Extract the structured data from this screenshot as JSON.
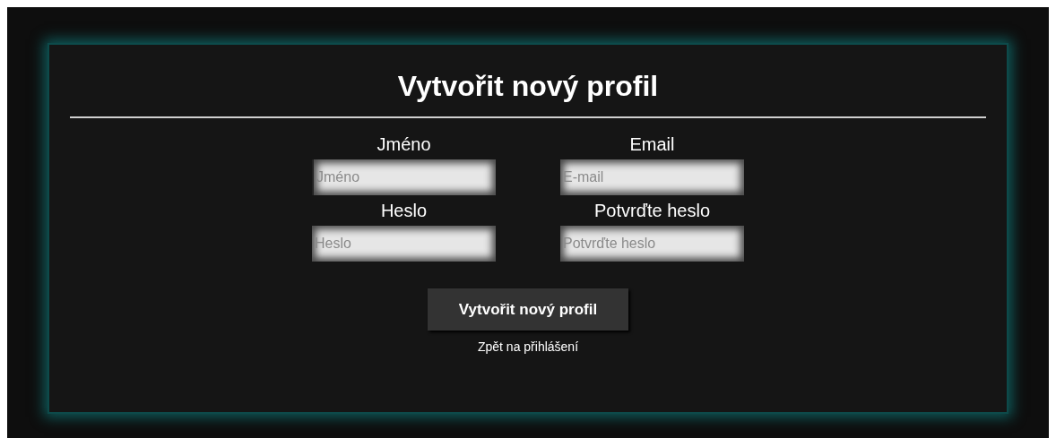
{
  "title": "Vytvořit nový profil",
  "fields": [
    {
      "label": "Jméno",
      "placeholder": "Jméno",
      "focused": true
    },
    {
      "label": "Email",
      "placeholder": "E-mail",
      "focused": false
    },
    {
      "label": "Heslo",
      "placeholder": "Heslo",
      "focused": false
    },
    {
      "label": "Potvrďte heslo",
      "placeholder": "Potvrďte heslo",
      "focused": false
    }
  ],
  "submit": "Vytvořit nový profil",
  "back_link": "Zpět na přihlášení"
}
